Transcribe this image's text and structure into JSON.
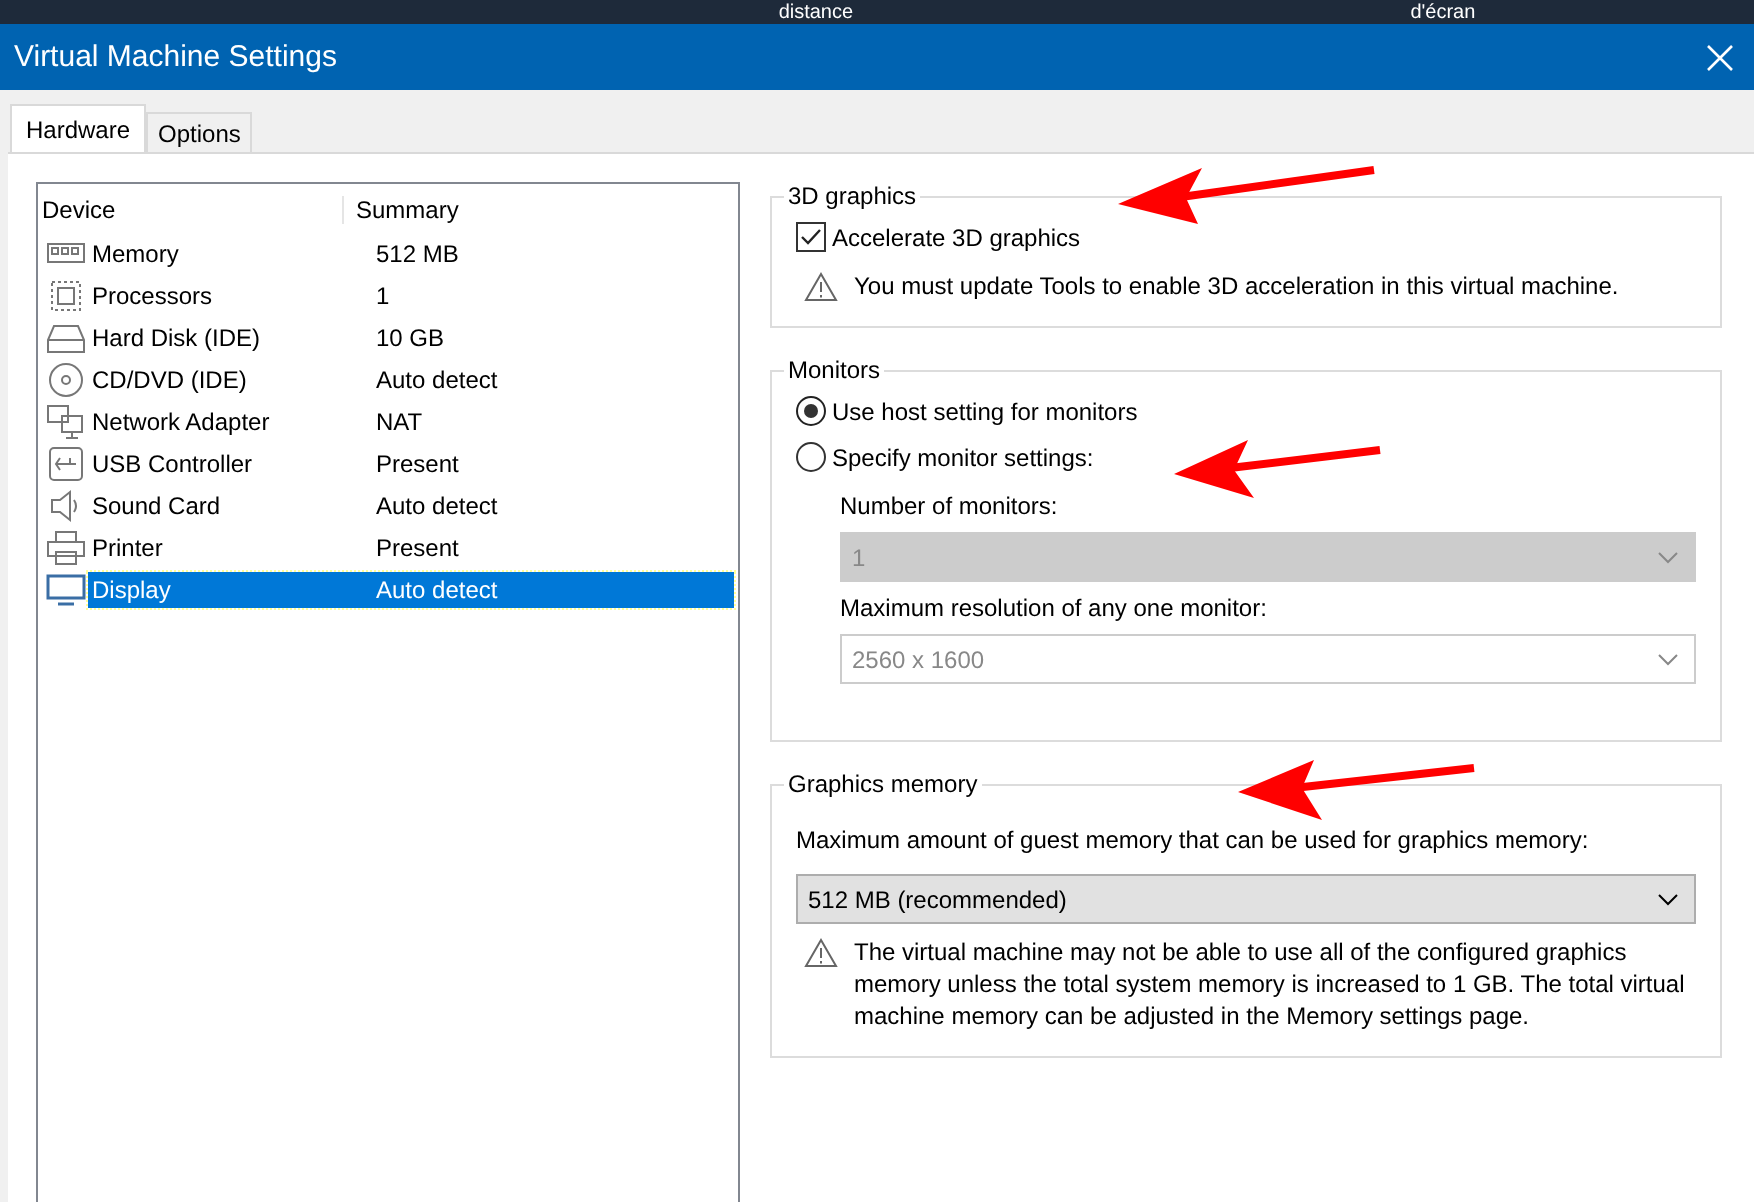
{
  "background": {
    "texts": [
      "distance",
      "d'écran"
    ]
  },
  "window": {
    "title": "Virtual Machine Settings"
  },
  "tabs": [
    {
      "label": "Hardware",
      "selected": true
    },
    {
      "label": "Options",
      "selected": false
    }
  ],
  "device_table": {
    "columns": [
      "Device",
      "Summary"
    ],
    "rows": [
      {
        "device": "Memory",
        "summary": "512 MB",
        "selected": false
      },
      {
        "device": "Processors",
        "summary": "1",
        "selected": false
      },
      {
        "device": "Hard Disk (IDE)",
        "summary": "10 GB",
        "selected": false
      },
      {
        "device": "CD/DVD (IDE)",
        "summary": "Auto detect",
        "selected": false
      },
      {
        "device": "Network Adapter",
        "summary": "NAT",
        "selected": false
      },
      {
        "device": "USB Controller",
        "summary": "Present",
        "selected": false
      },
      {
        "device": "Sound Card",
        "summary": "Auto detect",
        "selected": false
      },
      {
        "device": "Printer",
        "summary": "Present",
        "selected": false
      },
      {
        "device": "Display",
        "summary": "Auto detect",
        "selected": true
      }
    ]
  },
  "graphics_3d": {
    "title": "3D graphics",
    "accelerate": {
      "label": "Accelerate 3D graphics",
      "checked": true
    },
    "warning": "You must update Tools to enable 3D acceleration in this virtual machine."
  },
  "monitors": {
    "title": "Monitors",
    "options": [
      {
        "label": "Use host setting for monitors",
        "selected": true
      },
      {
        "label": "Specify monitor settings:",
        "selected": false
      }
    ],
    "number_of_monitors": {
      "label": "Number of monitors:",
      "value": "1",
      "disabled": true
    },
    "max_resolution": {
      "label": "Maximum resolution of any one monitor:",
      "value": "2560 x 1600",
      "disabled": true
    }
  },
  "graphics_memory": {
    "title": "Graphics memory",
    "label": "Maximum amount of guest memory that can be used for graphics memory:",
    "value": "512 MB (recommended)",
    "disabled": false,
    "warning": "The virtual machine may not be able to use all of the configured graphics memory unless the total system memory is increased to 1 GB. The total virtual machine memory can be adjusted in the Memory settings page."
  }
}
